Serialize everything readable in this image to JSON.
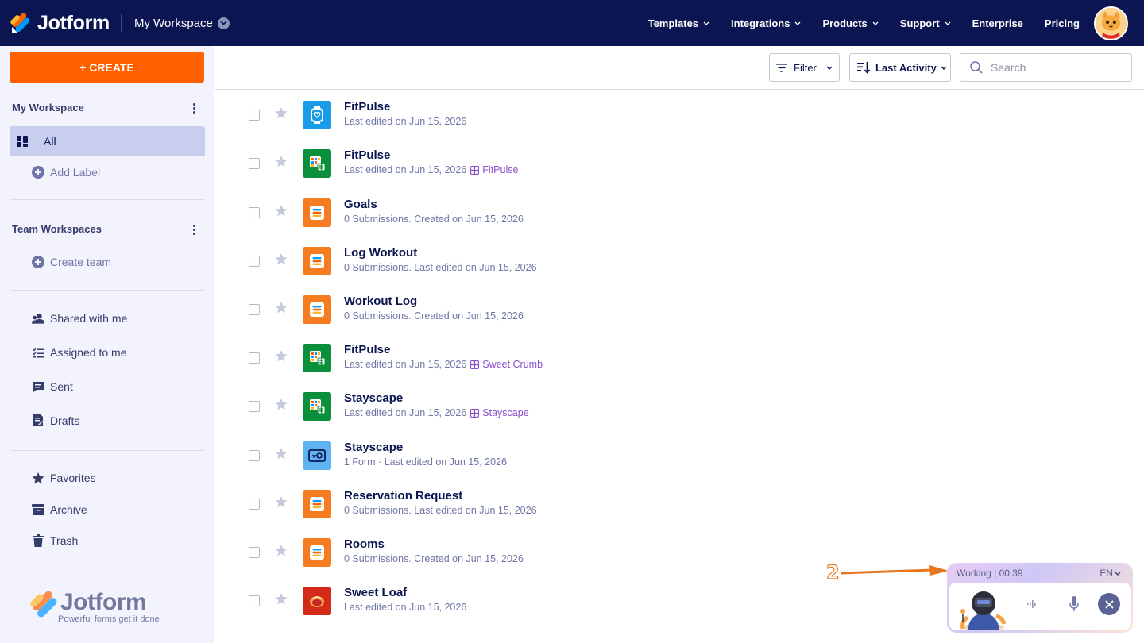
{
  "header": {
    "brand": "Jotform",
    "workspace": "My Workspace",
    "nav": [
      {
        "label": "Templates",
        "has_caret": true
      },
      {
        "label": "Integrations",
        "has_caret": true
      },
      {
        "label": "Products",
        "has_caret": true
      },
      {
        "label": "Support",
        "has_caret": true
      },
      {
        "label": "Enterprise",
        "has_caret": false
      },
      {
        "label": "Pricing",
        "has_caret": false
      }
    ]
  },
  "sidebar": {
    "create_label": "+ CREATE",
    "my_workspace_heading": "My Workspace",
    "all_label": "All",
    "add_label": "Add Label",
    "team_heading": "Team Workspaces",
    "create_team": "Create team",
    "shared_with_me": "Shared with me",
    "assigned_to_me": "Assigned to me",
    "sent": "Sent",
    "drafts": "Drafts",
    "favorites": "Favorites",
    "archive": "Archive",
    "trash": "Trash",
    "logo_wordmark": "Jotform",
    "logo_tagline": "Powerful forms get it done"
  },
  "toolbar": {
    "filter_label": "Filter",
    "sort_label": "Last Activity",
    "search_placeholder": "Search"
  },
  "items": [
    {
      "title": "FitPulse",
      "meta": "Last edited on Jun 15, 2026",
      "tag": "",
      "icon": "watch-app-icon"
    },
    {
      "title": "FitPulse",
      "meta": "Last edited on Jun 15, 2026",
      "tag": "FitPulse",
      "icon": "table-icon"
    },
    {
      "title": "Goals",
      "meta": "0 Submissions. Created on Jun 15, 2026",
      "tag": "",
      "icon": "form-icon"
    },
    {
      "title": "Log Workout",
      "meta": "0 Submissions. Last edited on Jun 15, 2026",
      "tag": "",
      "icon": "form-icon"
    },
    {
      "title": "Workout Log",
      "meta": "0 Submissions. Created on Jun 15, 2026",
      "tag": "",
      "icon": "form-icon"
    },
    {
      "title": "FitPulse",
      "meta": "Last edited on Jun 15, 2026",
      "tag": "Sweet Crumb",
      "icon": "table-icon"
    },
    {
      "title": "Stayscape",
      "meta": "Last edited on Jun 15, 2026",
      "tag": "Stayscape",
      "icon": "table-icon"
    },
    {
      "title": "Stayscape",
      "meta": "1 Form · Last edited on Jun 15, 2026",
      "tag": "",
      "icon": "key-app-icon"
    },
    {
      "title": "Reservation Request",
      "meta": "0 Submissions. Last edited on Jun 15, 2026",
      "tag": "",
      "icon": "form-icon"
    },
    {
      "title": "Rooms",
      "meta": "0 Submissions. Created on Jun 15, 2026",
      "tag": "",
      "icon": "form-icon"
    },
    {
      "title": "Sweet Loaf",
      "meta": "Last edited on Jun 15, 2026",
      "tag": "",
      "icon": "bread-app-icon"
    }
  ],
  "annotation": {
    "number": "2"
  },
  "agent": {
    "status": "Working | 00:39",
    "language": "EN"
  },
  "colors": {
    "navy": "#0a1551",
    "orange": "#ff6100",
    "form_orange": "#f67c22",
    "table_green": "#0a8f3b",
    "app_blue": "#1a9be8",
    "tag_purple": "#8a4fce"
  }
}
